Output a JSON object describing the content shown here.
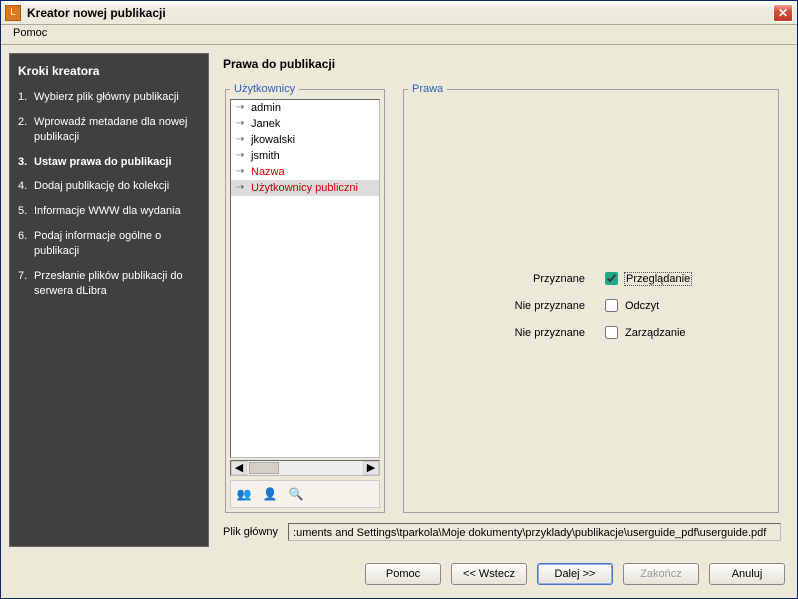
{
  "window": {
    "title": "Kreator nowej publikacji",
    "icon_letter": "L"
  },
  "menu": {
    "help": "Pomoc"
  },
  "sidebar": {
    "title": "Kroki kreatora",
    "steps": [
      {
        "num": "1.",
        "label": "Wybierz plik główny publikacji",
        "current": false
      },
      {
        "num": "2.",
        "label": "Wprowadź metadane dla nowej publikacji",
        "current": false
      },
      {
        "num": "3.",
        "label": "Ustaw prawa do publikacji",
        "current": true
      },
      {
        "num": "4.",
        "label": "Dodaj publikację do kolekcji",
        "current": false
      },
      {
        "num": "5.",
        "label": "Informacje WWW dla wydania",
        "current": false
      },
      {
        "num": "6.",
        "label": "Podaj informacje ogólne o publikacji",
        "current": false
      },
      {
        "num": "7.",
        "label": "Przesłanie plików publikacji do serwera dLibra",
        "current": false
      }
    ]
  },
  "main": {
    "title": "Prawa do publikacji",
    "users_legend": "Użytkownicy",
    "rights_legend": "Prawa",
    "users": [
      {
        "label": "admin",
        "selected": false,
        "red": false
      },
      {
        "label": "Janek",
        "selected": false,
        "red": false
      },
      {
        "label": "jkowalski",
        "selected": false,
        "red": false
      },
      {
        "label": "jsmith",
        "selected": false,
        "red": false
      },
      {
        "label": "Nazwa",
        "selected": false,
        "red": true
      },
      {
        "label": "Użytkownicy publiczni",
        "selected": true,
        "red": true
      }
    ],
    "rights": [
      {
        "status": "Przyznane",
        "label": "Przeglądanie",
        "checked": true,
        "focused": true
      },
      {
        "status": "Nie przyznane",
        "label": "Odczyt",
        "checked": false,
        "focused": false
      },
      {
        "status": "Nie przyznane",
        "label": "Zarządzanie",
        "checked": false,
        "focused": false
      }
    ],
    "path_label": "Plik główny",
    "path_value": ":uments and Settings\\tparkola\\Moje dokumenty\\przyklady\\publikacje\\userguide_pdf\\userguide.pdf",
    "toolbar_icons": {
      "group": "users-red-icon",
      "single": "user-icon",
      "search": "search-user-icon"
    }
  },
  "buttons": {
    "help": "Pomoc",
    "back": "<< Wstecz",
    "next": "Dalej >>",
    "finish": "Zakończ",
    "cancel": "Anuluj"
  }
}
